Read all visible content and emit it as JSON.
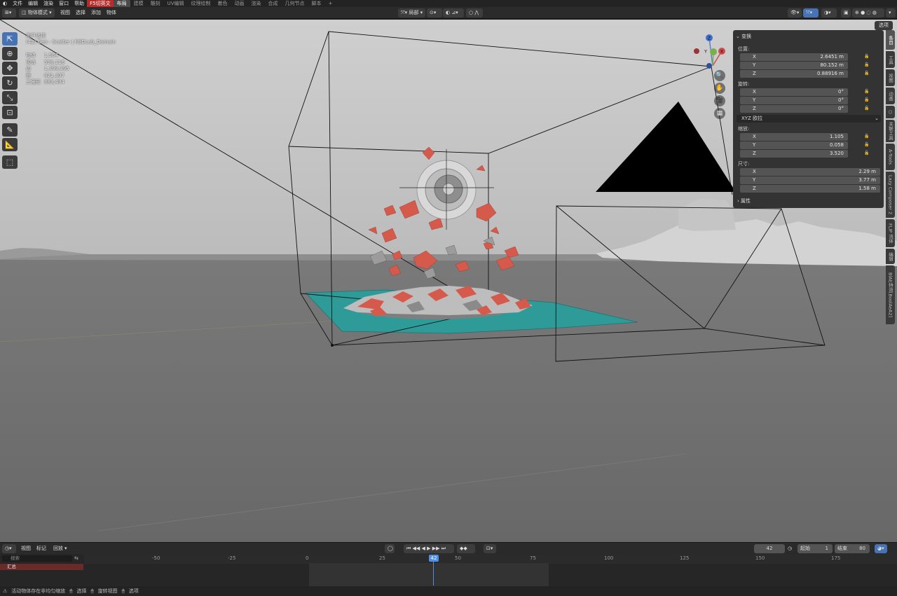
{
  "menubar": {
    "menus": [
      "文件",
      "编辑",
      "渲染",
      "窗口",
      "帮助"
    ],
    "addon_button": "F5切英文",
    "workspaces": [
      "布局",
      "建模",
      "雕刻",
      "UV编辑",
      "纹理绘制",
      "着色",
      "动画",
      "渲染",
      "合成",
      "几何节点",
      "脚本"
    ],
    "active_workspace": "布局",
    "add_tab": "+"
  },
  "header": {
    "mode": "物体模式",
    "menus": [
      "视图",
      "选择",
      "添加",
      "物体"
    ],
    "transform_orientation": "局部",
    "options": "选项"
  },
  "viewport": {
    "view_name": "用户透视",
    "object_info": "(42) Geo - Scatter | RBDLab_Domain",
    "stats": [
      {
        "label": "物体",
        "value": "1,564"
      },
      {
        "label": "顶点",
        "value": "598,116"
      },
      {
        "label": "边",
        "value": "1,399,395"
      },
      {
        "label": "面",
        "value": "821,307"
      },
      {
        "label": "三角形",
        "value": "883,494"
      }
    ],
    "gizmo": {
      "x": "X",
      "y": "Y",
      "z": "Z"
    }
  },
  "npanel": {
    "transform_title": "变换",
    "location_label": "位置:",
    "location": [
      {
        "axis": "X",
        "value": "2.6451 m"
      },
      {
        "axis": "Y",
        "value": "80.152 m"
      },
      {
        "axis": "Z",
        "value": "0.88916 m"
      }
    ],
    "rotation_label": "旋转:",
    "rotation": [
      {
        "axis": "X",
        "value": "0°"
      },
      {
        "axis": "Y",
        "value": "0°"
      },
      {
        "axis": "Z",
        "value": "0°"
      }
    ],
    "rotation_mode": "XYZ 欧拉",
    "scale_label": "缩放:",
    "scale": [
      {
        "axis": "X",
        "value": "1.105"
      },
      {
        "axis": "Y",
        "value": "0.058"
      },
      {
        "axis": "Z",
        "value": "3.520"
      }
    ],
    "dimensions_label": "尺寸:",
    "dimensions": [
      {
        "axis": "X",
        "value": "2.29 m"
      },
      {
        "axis": "Y",
        "value": "3.77 m"
      },
      {
        "axis": "Z",
        "value": "1.58 m"
      }
    ],
    "properties_title": "属性"
  },
  "sidetabs": [
    "条目",
    "工具",
    "视图",
    "动画",
    "",
    "关联工具",
    "A-Tools",
    "Lazy Composer 2",
    "FLIP 流体",
    "编辑",
    "BlAE特效[BoolAeA2]"
  ],
  "timeline": {
    "menus": [
      "视图",
      "标记",
      "回放"
    ],
    "current_frame": "42",
    "start_label": "起始",
    "start": "1",
    "end_label": "结束",
    "end": "80",
    "search_placeholder": "搜索",
    "summary": "汇总",
    "ticks": [
      "-50",
      "-25",
      "0",
      "25",
      "50",
      "75",
      "100",
      "125",
      "150",
      "175"
    ],
    "playhead": "42"
  },
  "statusbar": {
    "items": [
      "活动物体存在非均匀缩放",
      "选择",
      "旋转视图",
      "选项"
    ]
  },
  "colors": {
    "accent": "#4772b3",
    "addon_red": "#b32d2d",
    "debris_red": "#d65a4c",
    "teal_plane": "#2f9c98"
  }
}
